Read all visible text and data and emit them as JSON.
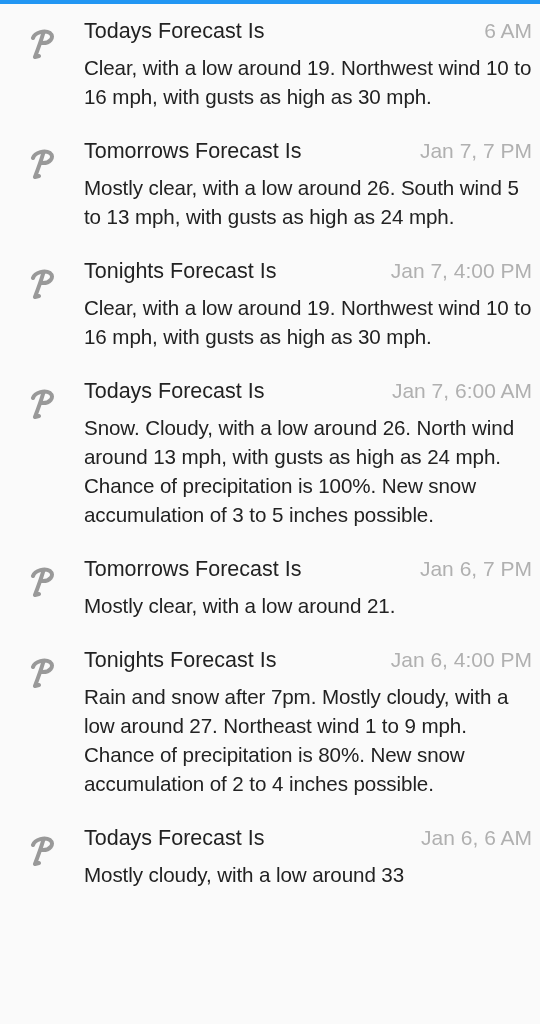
{
  "notifications": [
    {
      "title": "Todays Forecast Is",
      "time": "6 AM",
      "body": "Clear, with a low around 19. Northwest wind 10 to 16 mph, with gusts as high as 30 mph."
    },
    {
      "title": "Tomorrows Forecast Is",
      "time": "Jan 7, 7 PM",
      "body": "Mostly clear, with a low around 26. South wind 5 to 13 mph, with gusts as high as 24 mph."
    },
    {
      "title": "Tonights Forecast Is",
      "time": "Jan 7, 4:00 PM",
      "body": "Clear, with a low around 19. Northwest wind 10 to 16 mph, with gusts as high as 30 mph."
    },
    {
      "title": "Todays Forecast Is",
      "time": "Jan 7, 6:00 AM",
      "body": "Snow. Cloudy, with a low around 26. North wind around 13 mph, with gusts as high as 24 mph. Chance of precipitation is 100%. New snow accumulation of 3 to 5 inches possible."
    },
    {
      "title": "Tomorrows Forecast Is",
      "time": "Jan 6, 7 PM",
      "body": "Mostly clear, with a low around 21."
    },
    {
      "title": "Tonights Forecast Is",
      "time": "Jan 6, 4:00 PM",
      "body": "Rain and snow after 7pm. Mostly cloudy, with a low around 27. Northeast wind 1 to 9 mph. Chance of precipitation is 80%. New snow accumulation of 2 to 4 inches possible."
    },
    {
      "title": "Todays Forecast Is",
      "time": "Jan 6, 6 AM",
      "body": "Mostly cloudy, with a low around 33"
    }
  ]
}
